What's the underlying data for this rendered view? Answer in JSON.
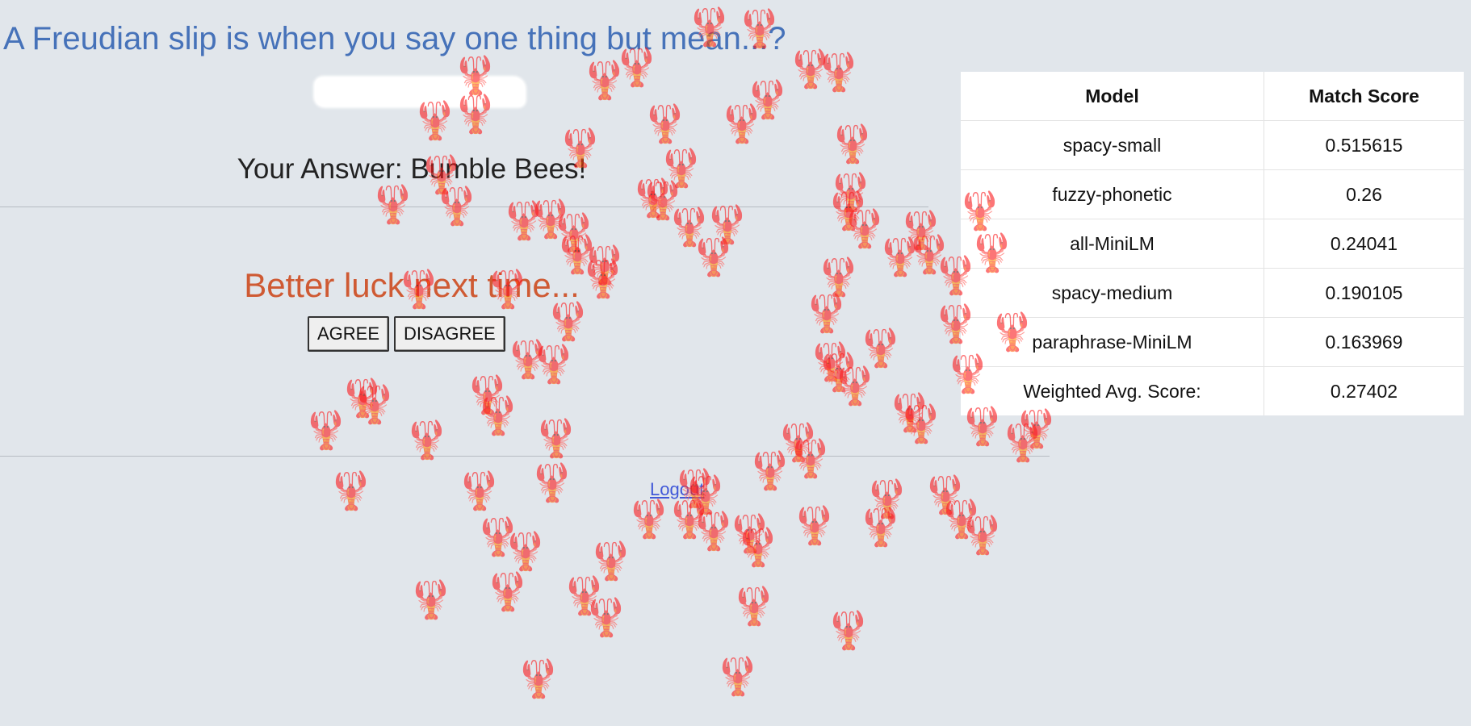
{
  "question": "A Freudian slip is when you say one thing but mean...?",
  "answer_label": "Your Answer: Bumble Bees!",
  "feedback": "Better luck next time...",
  "buttons": {
    "agree": "AGREE",
    "disagree": "DISAGREE"
  },
  "logout": "Logout",
  "score_table": {
    "headers": [
      "Model",
      "Match Score"
    ],
    "rows": [
      {
        "model": "spacy-small",
        "score": "0.515615"
      },
      {
        "model": "fuzzy-phonetic",
        "score": "0.26"
      },
      {
        "model": "all-MiniLM",
        "score": "0.24041"
      },
      {
        "model": "spacy-medium",
        "score": "0.190105"
      },
      {
        "model": "paraphrase-MiniLM",
        "score": "0.163969"
      },
      {
        "model": "Weighted Avg. Score:",
        "score": "0.27402"
      }
    ]
  },
  "decoration": {
    "icon": "lobster-icon",
    "glyph": "🦞",
    "color": "#e0473f"
  },
  "colors": {
    "background": "#e1e6eb",
    "question": "#4672b9",
    "feedback": "#cf5a33",
    "link": "#4058d8"
  }
}
